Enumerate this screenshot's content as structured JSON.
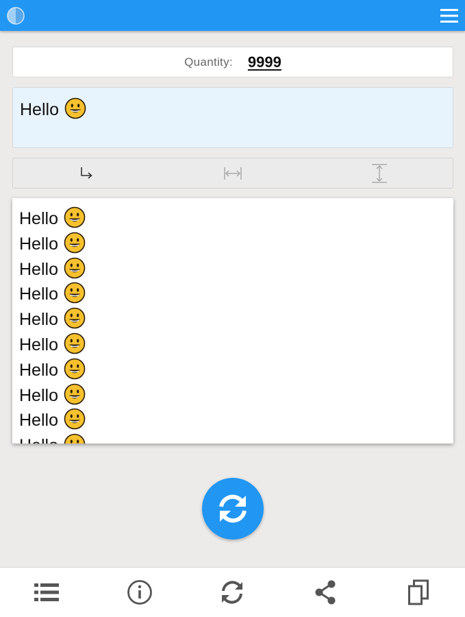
{
  "topbar": {
    "accent_color": "#2196f3",
    "left_icon": "half-circle-theme-icon",
    "right_icon": "hamburger-menu-icon"
  },
  "quantity": {
    "label": "Quantity:",
    "value": "9999"
  },
  "input": {
    "text": "Hello",
    "emoji_icon": "smiling-face-emoji-icon"
  },
  "toolbar": {
    "buttons": [
      {
        "icon": "newline-arrow-icon"
      },
      {
        "icon": "horizontal-resize-icon"
      },
      {
        "icon": "vertical-resize-icon"
      }
    ]
  },
  "output": {
    "lines": [
      "Hello",
      "Hello",
      "Hello",
      "Hello",
      "Hello",
      "Hello",
      "Hello",
      "Hello",
      "Hello",
      "Hello"
    ]
  },
  "fab": {
    "icon": "refresh-sync-icon",
    "color": "#2196f3"
  },
  "bottom_nav": {
    "items": [
      {
        "icon": "list-icon"
      },
      {
        "icon": "info-icon"
      },
      {
        "icon": "refresh-icon"
      },
      {
        "icon": "share-icon"
      },
      {
        "icon": "copy-icon"
      }
    ]
  }
}
